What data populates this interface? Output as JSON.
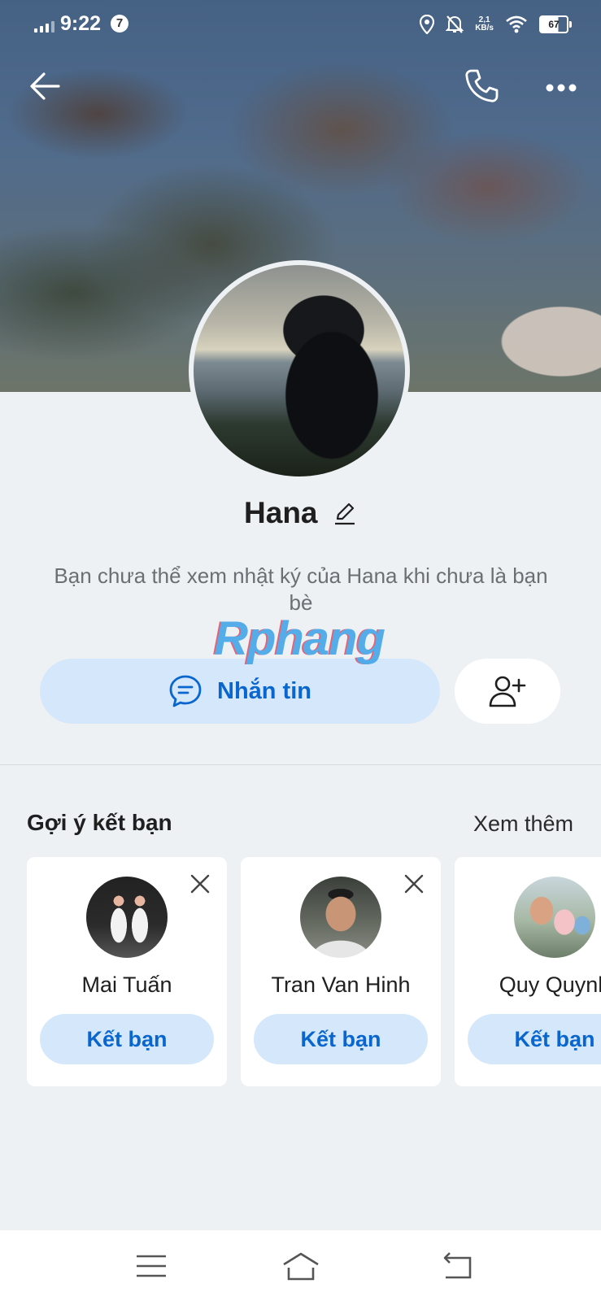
{
  "status_bar": {
    "time": "9:22",
    "notification_count": "7",
    "net_speed_value": "2,1",
    "net_speed_unit": "KB/s",
    "battery": "67"
  },
  "profile": {
    "name": "Hana",
    "notice": "Bạn chưa thể xem nhật ký của Hana khi chưa là bạn bè",
    "watermark": "Rphang"
  },
  "actions": {
    "message_label": "Nhắn tin"
  },
  "suggestions": {
    "title": "Gợi ý kết bạn",
    "see_more": "Xem thêm",
    "items": [
      {
        "name": "Mai Tuấn",
        "button": "Kết bạn"
      },
      {
        "name": "Tran Van Hinh",
        "button": "Kết bạn"
      },
      {
        "name": "Quy Quynh",
        "button": "Kết bạn"
      }
    ]
  },
  "colors": {
    "accent": "#0a66cf",
    "button_bg": "#d5e7fb",
    "page_bg": "#eef1f4"
  },
  "icons": {
    "back": "arrow-left-icon",
    "call": "phone-icon",
    "more": "more-horizontal-icon",
    "edit": "pencil-icon",
    "message": "chat-bubble-icon",
    "add_friend": "add-user-icon",
    "close": "close-icon",
    "menu": "menu-icon",
    "home": "home-icon",
    "return": "return-icon"
  }
}
